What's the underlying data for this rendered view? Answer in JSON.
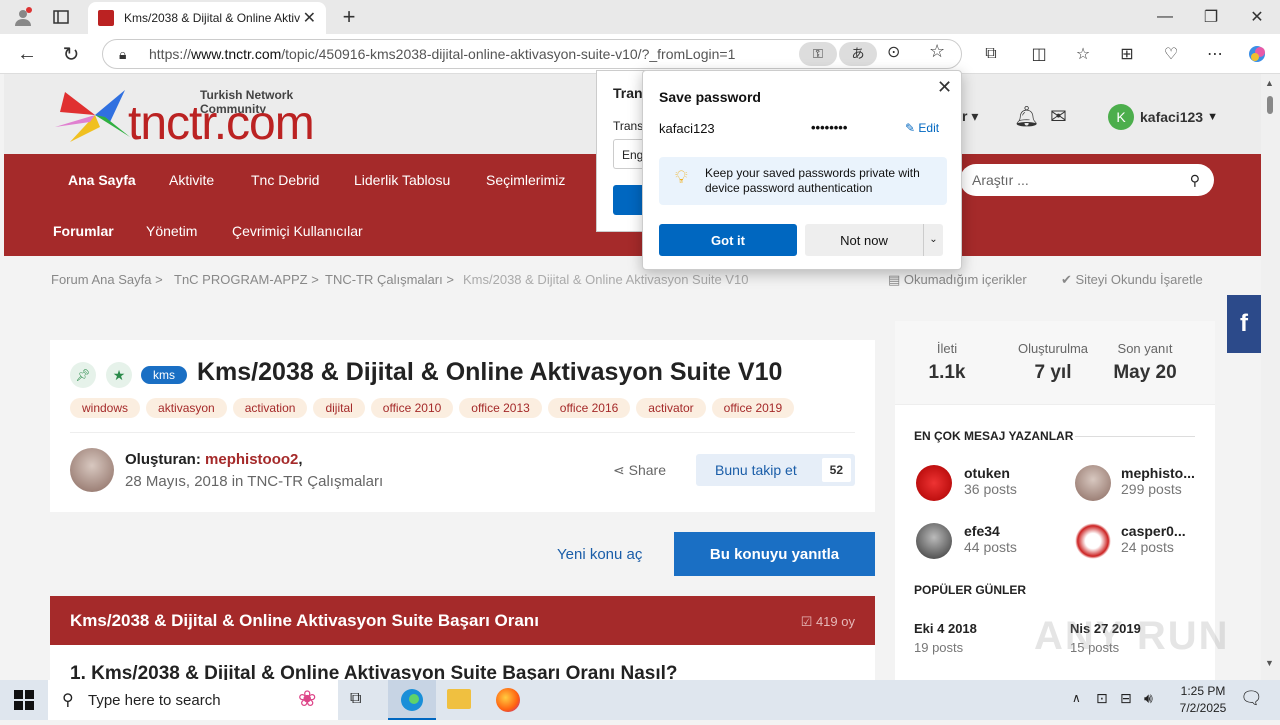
{
  "browser": {
    "tab_title": "Kms/2038 & Dijital & Online Aktiv",
    "url": "https://www.tnctr.com/topic/450916-kms2038-dijital-online-aktivasyon-suite-v10/?_fromLogin=1",
    "url_host": "www.tnctr.com",
    "url_prefix": "https://",
    "url_path": "/topic/450916-kms2038-dijital-online-aktivasyon-suite-v10/?_fromLogin=1"
  },
  "site": {
    "logo_tagline": "Turkish Network Community",
    "logo_text": "tnctr.com",
    "username": "kafaci123",
    "avatar_letter": "K",
    "nav_primary": [
      "Ana Sayfa",
      "Aktivite",
      "Tnc Debrid",
      "Liderlik Tablosu",
      "Seçimlerimiz"
    ],
    "nav_secondary": [
      "Forumlar",
      "Yönetim",
      "Çevrimiçi Kullanıcılar"
    ],
    "search_placeholder": "Araştır ...",
    "header_partial": "r"
  },
  "breadcrumb": [
    "Forum Ana Sayfa",
    "TnC PROGRAM-APPZ",
    "TNC-TR Çalışmaları",
    "Kms/2038 & Dijital & Online Aktivasyon Suite V10"
  ],
  "breadcrumb_actions": {
    "unread": "Okumadığım içerikler",
    "mark_read": "Siteyi Okundu İşaretle"
  },
  "topic": {
    "prefix": "kms",
    "title": "Kms/2038 & Dijital & Online Aktivasyon Suite V10",
    "tags": [
      "windows",
      "aktivasyon",
      "activation",
      "dijital",
      "office 2010",
      "office 2013",
      "office 2016",
      "activator",
      "office 2019"
    ],
    "author_label": "Oluşturan:",
    "author": "mephistooo2",
    "date_text": "28 Mayıs, 2018 in TNC-TR Çalışmaları",
    "share_label": "Share",
    "follow_label": "Bunu takip et",
    "follow_count": "52",
    "new_topic_label": "Yeni konu aç",
    "reply_label": "Bu konuyu yanıtla"
  },
  "poll": {
    "title": "Kms/2038 & Dijital & Online Aktivasyon Suite Başarı Oranı",
    "votes": "419 oy",
    "question": "1. Kms/2038 & Dijital & Online Aktivasyon Suite Başarı Oranı Nasıl?"
  },
  "sidebar": {
    "stats": [
      {
        "label": "İleti",
        "value": "1.1k"
      },
      {
        "label": "Oluşturulma",
        "value": "7 yıl"
      },
      {
        "label": "Son yanıt",
        "value": "May 20"
      }
    ],
    "top_posters_title": "EN ÇOK MESAJ YAZANLAR",
    "posters": [
      {
        "name": "otuken",
        "posts": "36 posts"
      },
      {
        "name": "mephisto...",
        "posts": "299 posts"
      },
      {
        "name": "efe34",
        "posts": "44 posts"
      },
      {
        "name": "casper0...",
        "posts": "24 posts"
      }
    ],
    "popular_days_title": "POPÜLER GÜNLER",
    "popular_days": [
      {
        "date": "Eki 4 2018",
        "posts": "19 posts"
      },
      {
        "date": "Nis 27 2019",
        "posts": "15 posts"
      }
    ]
  },
  "password_popup": {
    "title": "Save password",
    "username": "kafaci123",
    "password_mask": "••••••••",
    "edit_label": "Edit",
    "info_text": "Keep your saved passwords private with device password authentication",
    "got_it": "Got it",
    "not_now": "Not now"
  },
  "translate_popup": {
    "title_partial": "Tran",
    "label_partial": "Trans",
    "select_partial": "Eng"
  },
  "taskbar": {
    "search_placeholder": "Type here to search",
    "time": "1:25 PM",
    "date": "7/2/2025"
  },
  "watermark": "ANY RUN",
  "colors": {
    "brand": "#a52a2a",
    "primary_button": "#1a6fc4",
    "edge_blue": "#0067c0"
  }
}
